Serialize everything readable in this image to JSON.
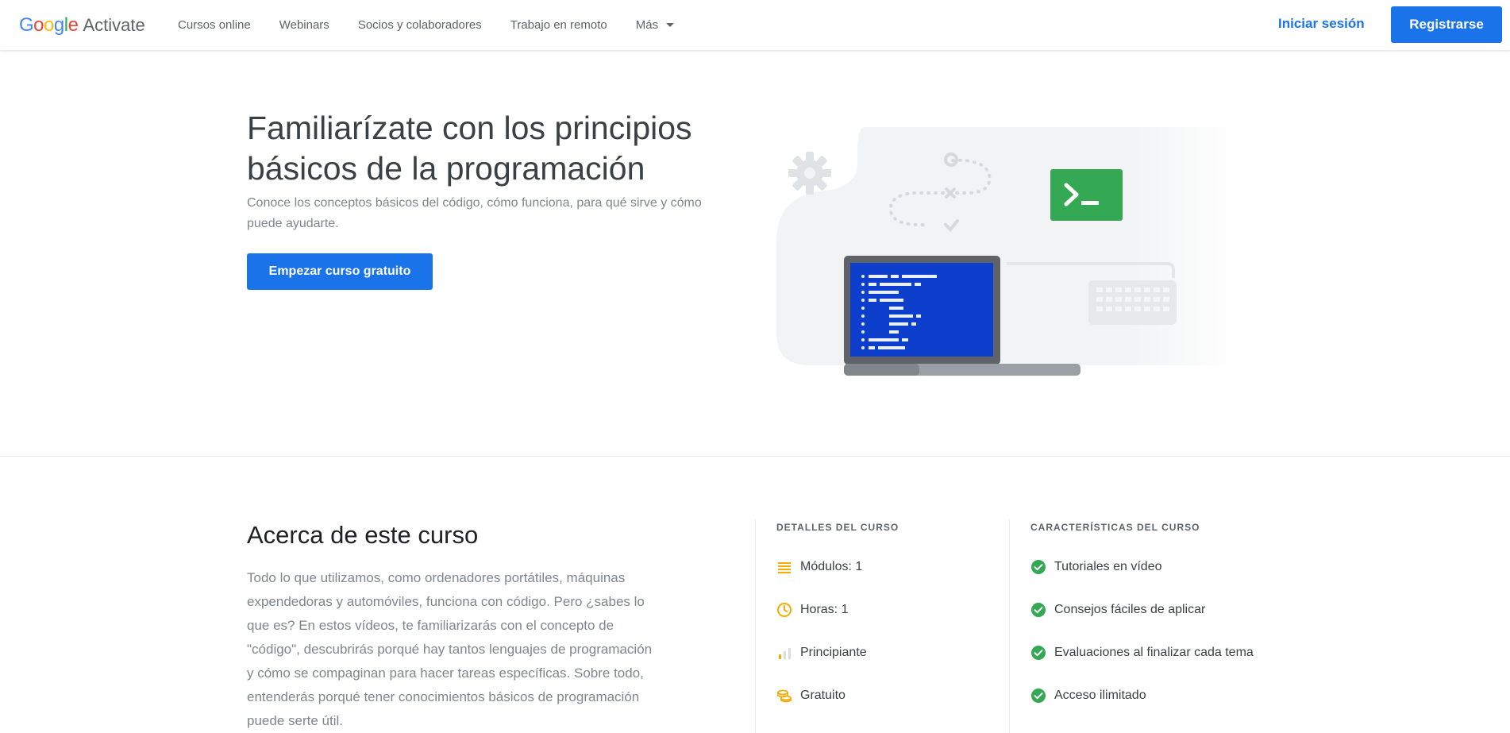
{
  "header": {
    "logo_google": "Google",
    "logo_product": "Activate",
    "nav": [
      "Cursos online",
      "Webinars",
      "Socios y colaboradores",
      "Trabajo en remoto",
      "Más"
    ],
    "signin_label": "Iniciar sesión",
    "register_label": "Registrarse"
  },
  "hero": {
    "title": "Familiarízate con los principios básicos de la programación",
    "subtitle": "Conoce los conceptos básicos del código, cómo funciona, para qué sirve y cómo puede ayudarte.",
    "cta_label": "Empezar curso gratuito",
    "illustration_icons": [
      "gear-icon",
      "terminal-icon",
      "laptop-icon",
      "keyboard-icon"
    ]
  },
  "about": {
    "title": "Acerca de este curso",
    "text": "Todo lo que utilizamos, como ordenadores portátiles, máquinas expendedoras y automóviles, funciona con código. Pero ¿sabes lo que es? En estos vídeos, te familiarizarás con el concepto de \"código\", descubrirás porqué hay tantos lenguajes de programación y cómo se compaginan para hacer tareas específicas. Sobre todo, entenderás porqué tener conocimientos básicos de programación puede serte útil."
  },
  "details": {
    "heading": "DETALLES DEL CURSO",
    "items": [
      {
        "icon": "list-icon",
        "label": "Módulos: 1"
      },
      {
        "icon": "clock-icon",
        "label": "Horas: 1"
      },
      {
        "icon": "level-bars-icon",
        "label": "Principiante"
      },
      {
        "icon": "coins-icon",
        "label": "Gratuito"
      }
    ]
  },
  "features": {
    "heading": "CARACTERÍSTICAS DEL CURSO",
    "items": [
      {
        "icon": "check-circle-icon",
        "label": "Tutoriales en vídeo"
      },
      {
        "icon": "check-circle-icon",
        "label": "Consejos fáciles de aplicar"
      },
      {
        "icon": "check-circle-icon",
        "label": "Evaluaciones al finalizar cada tema"
      },
      {
        "icon": "check-circle-icon",
        "label": "Acceso ilimitado"
      }
    ]
  },
  "colors": {
    "accent": "#1a73e8",
    "success": "#34a853",
    "warning": "#fbbc04",
    "terminal_green": "#34a853",
    "screen_blue": "#0d3fcc"
  }
}
